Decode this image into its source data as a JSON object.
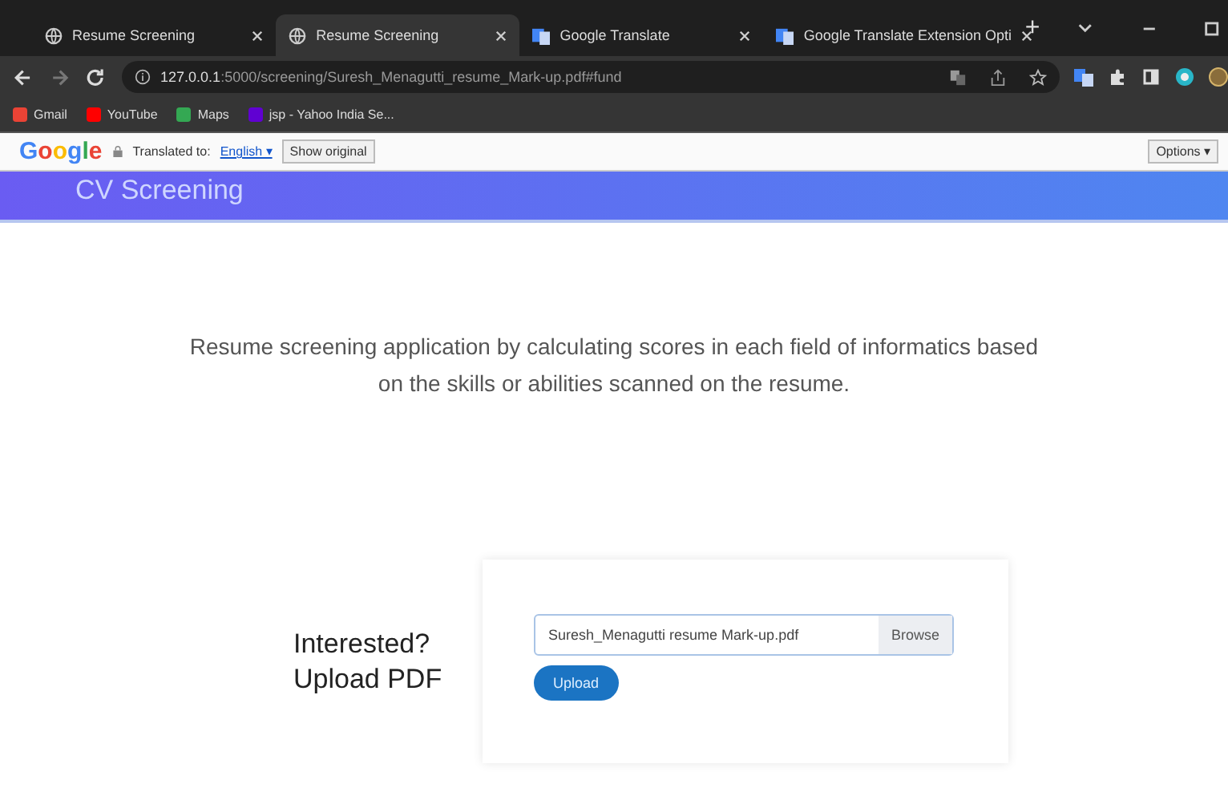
{
  "browser": {
    "tabs": [
      {
        "title": "Resume Screening",
        "selected": false,
        "kind": "globe"
      },
      {
        "title": "Resume Screening",
        "selected": true,
        "kind": "globe"
      },
      {
        "title": "Google Translate",
        "selected": false,
        "kind": "translate"
      },
      {
        "title": "Google Translate Extension Opti",
        "selected": false,
        "kind": "translate"
      }
    ],
    "new_tab": "+",
    "url_host": "127.0.0.1",
    "url_path": ":5000/screening/Suresh_Menagutti_resume_Mark-up.pdf#fund",
    "bookmarks": [
      {
        "label": "Gmail",
        "color": "#ea4335"
      },
      {
        "label": "YouTube",
        "color": "#ff0000"
      },
      {
        "label": "Maps",
        "color": "#34a853"
      },
      {
        "label": "jsp - Yahoo India Se...",
        "color": "#6001d2"
      }
    ]
  },
  "translate_bar": {
    "logo": "Google",
    "translated_to": "Translated to:",
    "language": "English ▾",
    "show_original": "Show original",
    "options": "Options ▾"
  },
  "page": {
    "header_title": "CV Screening",
    "description": "Resume screening application by calculating scores in each field of informatics based on the skills or abilities scanned on the resume.",
    "upload_prompt_1": "Interested?",
    "upload_prompt_2": "Upload PDF",
    "file_name": "Suresh_Menagutti resume Mark-up.pdf",
    "browse": "Browse",
    "upload": "Upload"
  }
}
